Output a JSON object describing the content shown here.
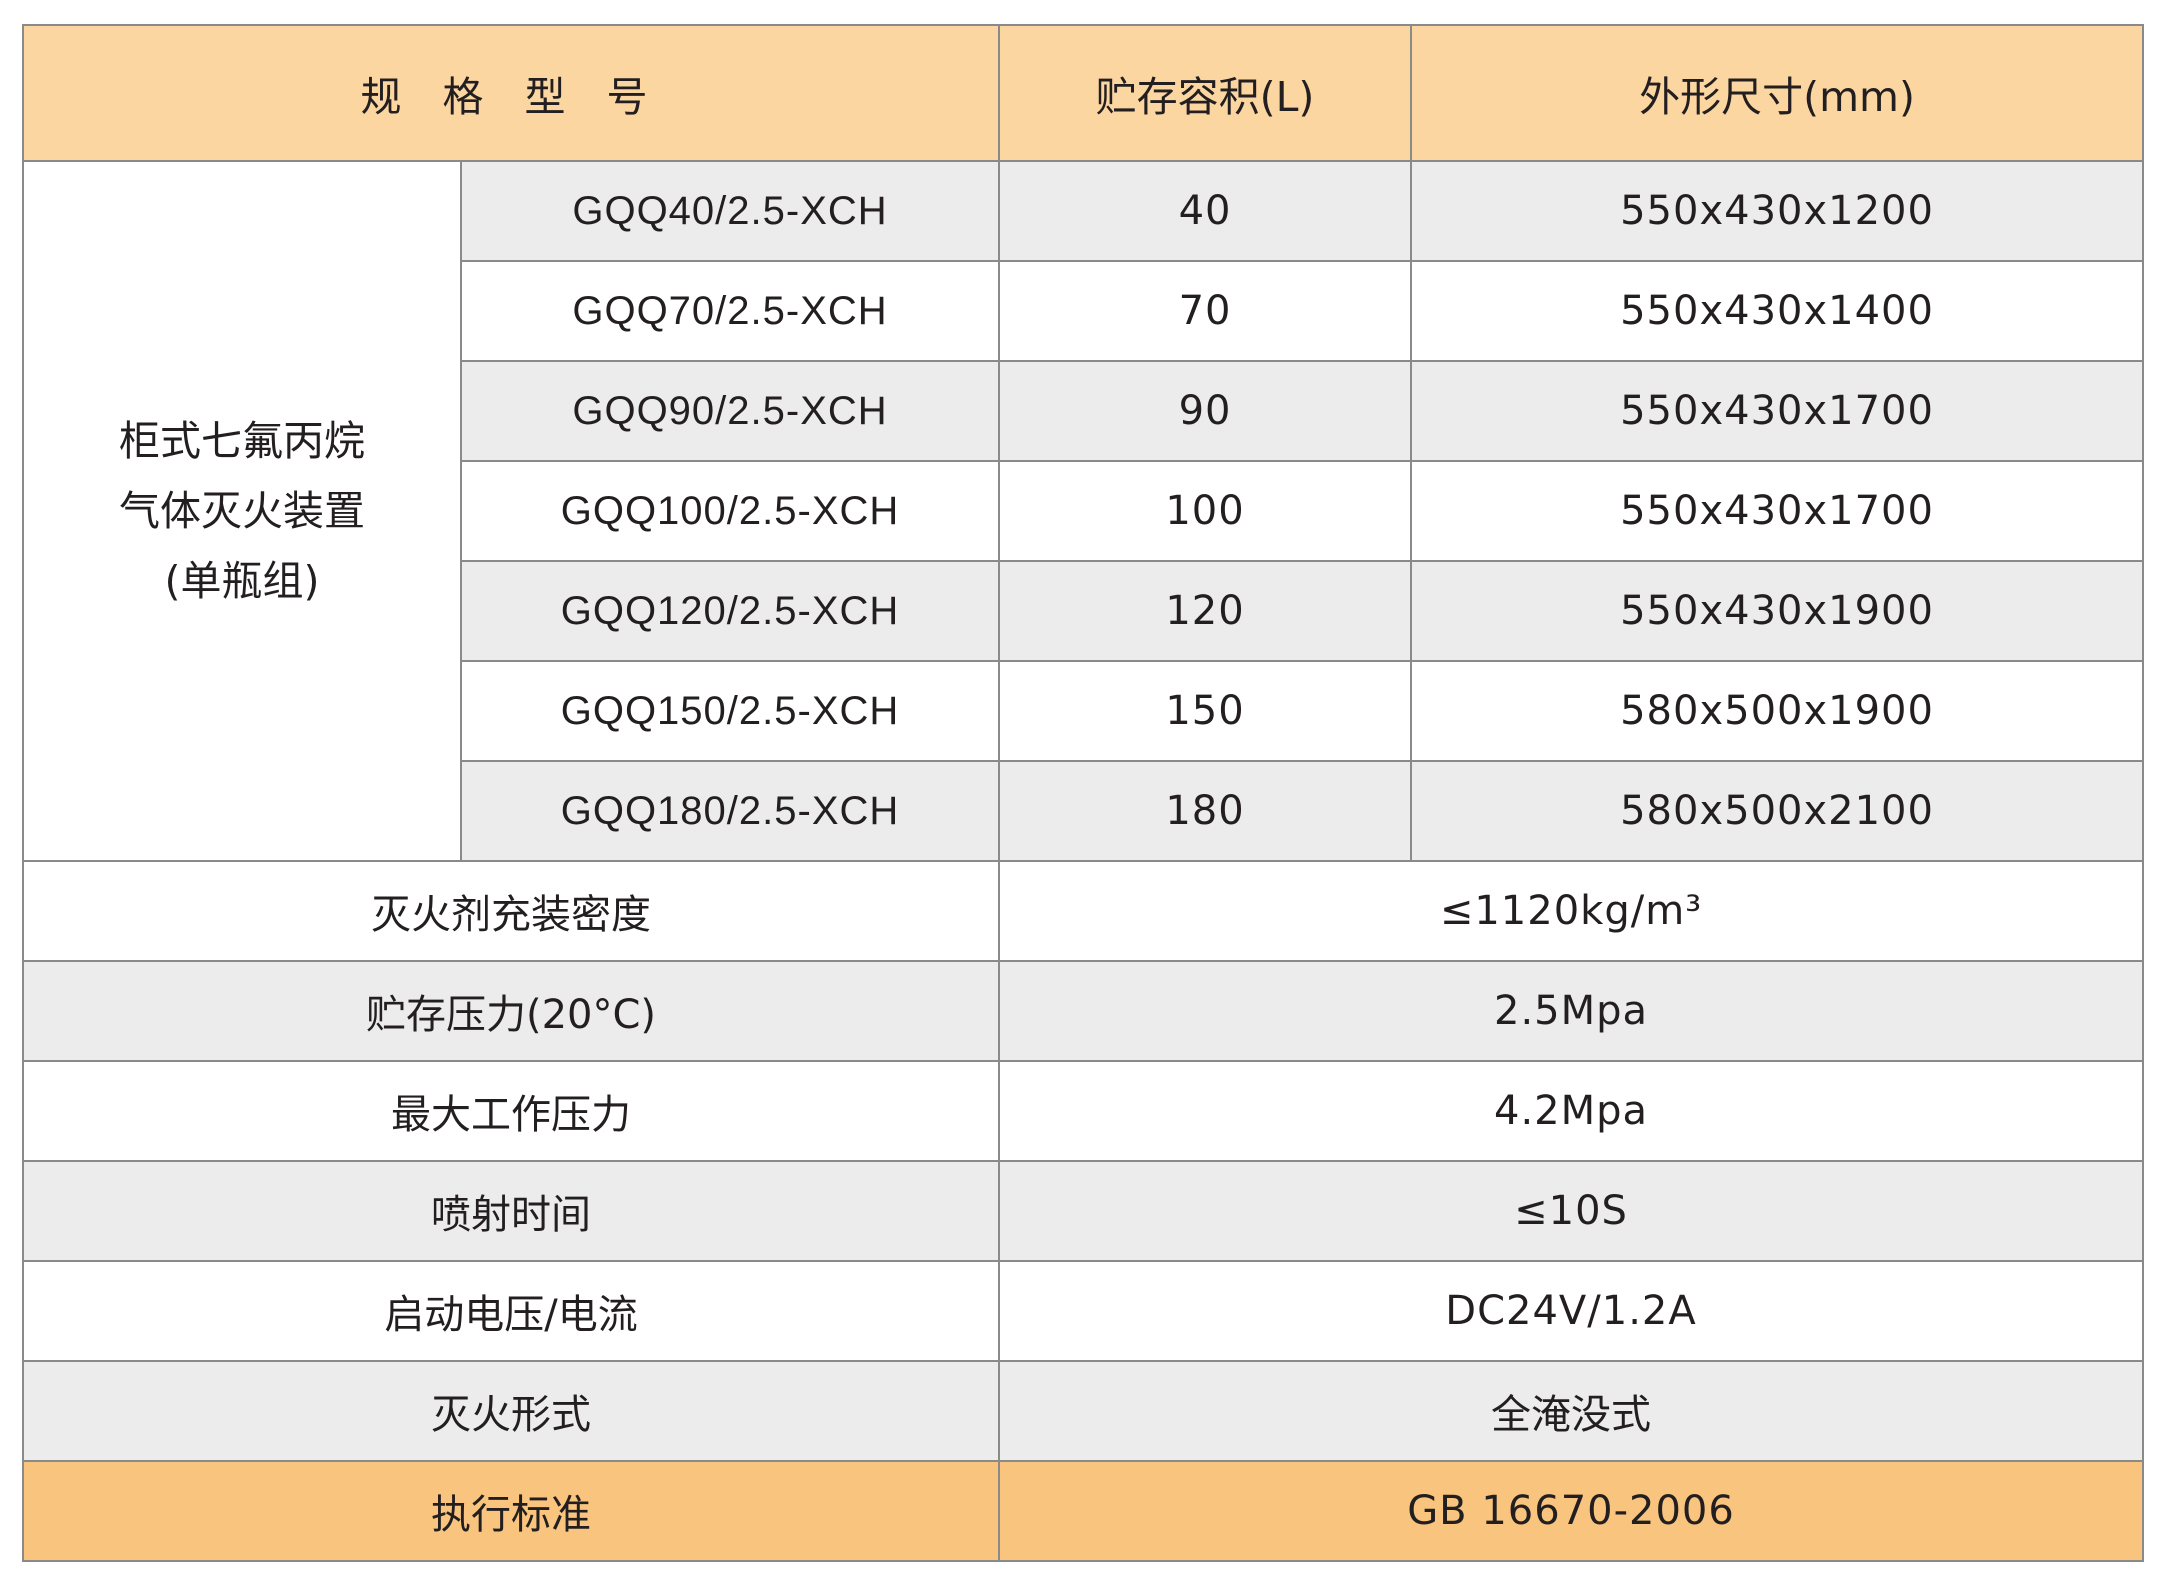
{
  "header": {
    "spec": "规 格 型 号",
    "volume": "贮存容积(L)",
    "size": "外形尺寸(mm)"
  },
  "group": {
    "line1": "柜式七氟丙烷",
    "line2": "气体灭火装置",
    "line3": "(单瓶组)"
  },
  "models": [
    {
      "model": "GQQ40/2.5-XCH",
      "volume": "40",
      "size": "550x430x1200"
    },
    {
      "model": "GQQ70/2.5-XCH",
      "volume": "70",
      "size": "550x430x1400"
    },
    {
      "model": "GQQ90/2.5-XCH",
      "volume": "90",
      "size": "550x430x1700"
    },
    {
      "model": "GQQ100/2.5-XCH",
      "volume": "100",
      "size": "550x430x1700"
    },
    {
      "model": "GQQ120/2.5-XCH",
      "volume": "120",
      "size": "550x430x1900"
    },
    {
      "model": "GQQ150/2.5-XCH",
      "volume": "150",
      "size": "580x500x1900"
    },
    {
      "model": "GQQ180/2.5-XCH",
      "volume": "180",
      "size": "580x500x2100"
    }
  ],
  "properties": [
    {
      "label": "灭火剂充装密度",
      "value": "≤1120kg/m³"
    },
    {
      "label": "贮存压力(20°C)",
      "value": "2.5Mpa"
    },
    {
      "label": "最大工作压力",
      "value": "4.2Mpa"
    },
    {
      "label": "喷射时间",
      "value": "≤10S"
    },
    {
      "label": "启动电压/电流",
      "value": "DC24V/1.2A"
    },
    {
      "label": "灭火形式",
      "value": "全淹没式"
    }
  ],
  "footer": {
    "label": "执行标准",
    "value": "GB 16670-2006"
  },
  "colors": {
    "header_bg": "#fcd6a1",
    "footer_bg": "#f8c47e",
    "stripe_bg": "#ececec",
    "border": "#8a8a8a"
  }
}
